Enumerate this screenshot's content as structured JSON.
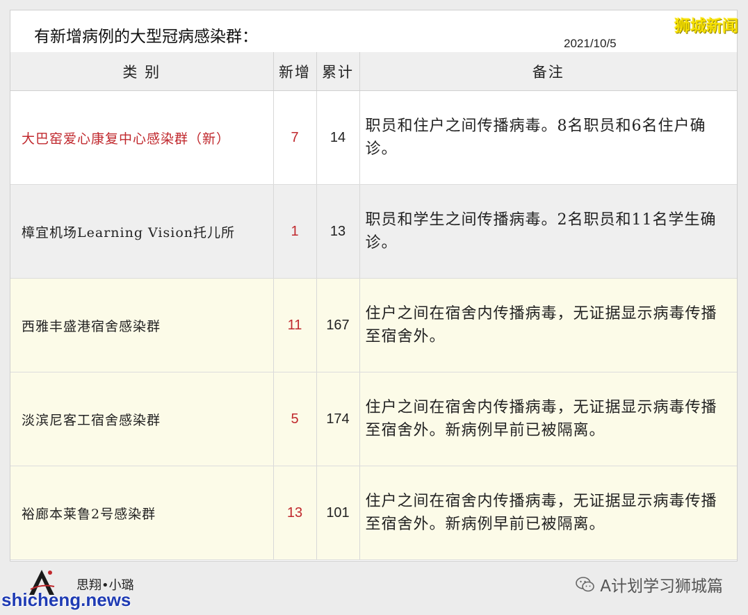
{
  "header": {
    "title": "有新增病例的大型冠病感染群：",
    "date": "2021/10/5",
    "watermark": "狮城新闻"
  },
  "table": {
    "columns": [
      "类  别",
      "新增",
      "累计",
      "备注"
    ],
    "rows": [
      {
        "category": "大巴窑爱心康复中心感染群（新）",
        "new": "7",
        "total": "14",
        "note": "职员和住户之间传播病毒。8名职员和6名住户确诊。"
      },
      {
        "category": "樟宜机场Learning Vision托儿所",
        "new": "1",
        "total": "13",
        "note": "职员和学生之间传播病毒。2名职员和11名学生确诊。"
      },
      {
        "category": "西雅丰盛港宿舍感染群",
        "new": "11",
        "total": "167",
        "note": "住户之间在宿舍内传播病毒，无证据显示病毒传播至宿舍外。"
      },
      {
        "category": "淡滨尼客工宿舍感染群",
        "new": "5",
        "total": "174",
        "note": "住户之间在宿舍内传播病毒，无证据显示病毒传播至宿舍外。新病例早前已被隔离。"
      },
      {
        "category": "裕廊本莱鲁2号感染群",
        "new": "13",
        "total": "101",
        "note": "住户之间在宿舍内传播病毒，无证据显示病毒传播至宿舍外。新病例早前已被隔离。"
      }
    ]
  },
  "footer": {
    "brand": "思翔•小璐",
    "site": "shicheng.news",
    "wechat": "A计划学习狮城篇"
  },
  "colors": {
    "accent_red": "#c0282d",
    "header_bg": "#efefef",
    "cream_bg": "#fcfbe8",
    "watermark_yellow": "#f6e000",
    "site_blue": "#1f3bb3"
  }
}
